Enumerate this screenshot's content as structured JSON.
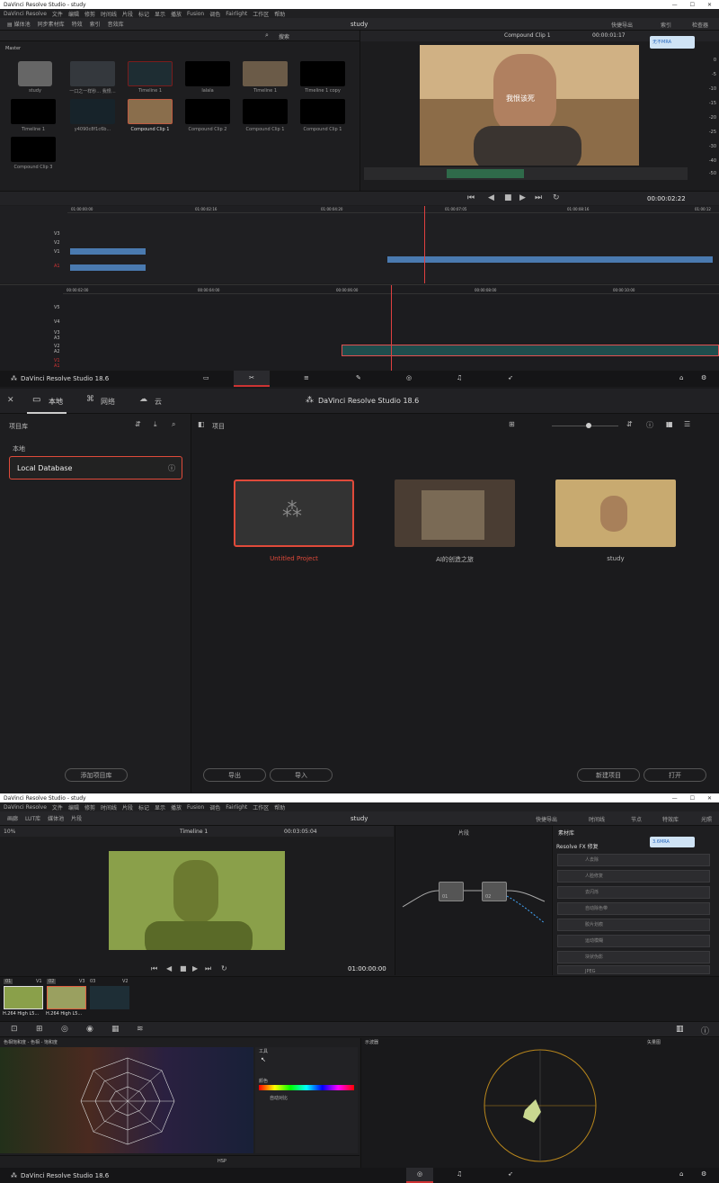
{
  "top": {
    "window_title": "DaVinci Resolve Studio - study",
    "menu": [
      "DaVinci Resolve",
      "文件",
      "编辑",
      "修剪",
      "时间线",
      "片段",
      "标记",
      "显示",
      "播放",
      "Fusion",
      "调色",
      "Fairlight",
      "工作区",
      "帮助"
    ],
    "toolbar": [
      "媒体池",
      "同步素材库",
      "特效",
      "索引",
      "音效库"
    ],
    "project_name": "study",
    "right_tools": [
      "快捷导出",
      "索引",
      "检查器"
    ],
    "search_label": "搜索",
    "bin_label": "Master",
    "clip_name": "Compound Clip 1",
    "timecode_top": "00:00:01:17",
    "badge": "无不MRA",
    "subtitle_overlay": "我恨该死",
    "timecode_main": "00:00:02:22",
    "ruler_top": [
      "01:00:00:00",
      "01:00:02:16",
      "01:00:04:20",
      "01:00:07:05",
      "01:00:08:16",
      "01:00:12"
    ],
    "ruler_bottom": [
      "00:00:02:00",
      "00:00:04:00",
      "00:00:06:00",
      "00:00:08:00",
      "00:00:10:00"
    ],
    "video_tracks": [
      "V3",
      "V2",
      "V1",
      "A1"
    ],
    "lower_tracks": [
      "V5",
      "V4",
      "V3",
      "A3",
      "V2",
      "A2",
      "V1",
      "A1"
    ],
    "meter_scale": [
      "0",
      "-5",
      "-10",
      "-15",
      "-20",
      "-25",
      "-30",
      "-40",
      "-50"
    ],
    "media": [
      {
        "name": "study"
      },
      {
        "name": "一口之一样秒…  我恨…"
      },
      {
        "name": "Timeline 1"
      },
      {
        "name": "lalala"
      },
      {
        "name": "Timeline 1"
      },
      {
        "name": "Timeline 1 copy"
      },
      {
        "name": "Timeline 1"
      },
      {
        "name": "y4090c8f1c6b..."
      },
      {
        "name": "Compound Clip 1"
      },
      {
        "name": "Compound Clip 2"
      },
      {
        "name": "Compound Clip 1"
      },
      {
        "name": "Compound Clip 1"
      },
      {
        "name": "Compound Clip 3"
      }
    ]
  },
  "mid": {
    "tabs": [
      "本地",
      "网络",
      "云"
    ],
    "app_title": "DaVinci Resolve Studio 18.6",
    "library_label": "项目库",
    "local_label": "本地",
    "database": "Local Database",
    "projects_label": "项目",
    "projects": [
      {
        "name": "Untitled Project"
      },
      {
        "name": "AI的创造之旅"
      },
      {
        "name": "study"
      }
    ],
    "add_library": "添加项目库",
    "export": "导出",
    "import": "导入",
    "new_project": "新建项目",
    "open": "打开"
  },
  "bot": {
    "window_title": "DaVinci Resolve Studio - study",
    "menu": [
      "DaVinci Resolve",
      "文件",
      "编辑",
      "修剪",
      "时间线",
      "片段",
      "标记",
      "显示",
      "播放",
      "Fusion",
      "调色",
      "Fairlight",
      "工作区",
      "帮助"
    ],
    "toolbar": [
      "画廊",
      "LUT库",
      "媒体池",
      "片段"
    ],
    "project_name": "study",
    "right_tools": [
      "快捷导出",
      "时间线",
      "节点",
      "特效库",
      "光照"
    ],
    "zoom": "10%",
    "timeline": "Timeline 1",
    "timecode_top": "00:03:05:04",
    "node_label": "片段",
    "fx_tab": "素材库",
    "fx_title": "Resolve FX 修复",
    "fx_items": [
      "人去除",
      "人脸修复",
      "去闪烁",
      "自动除色带",
      "胶片划痕",
      "运动模糊",
      "块状伪影",
      "JPEG"
    ],
    "timecode_main": "01:00:00:00",
    "clips": [
      {
        "id": "01",
        "track": "V1",
        "codec": "H.264 High L5..."
      },
      {
        "id": "02",
        "track": "V3",
        "codec": "H.264 High L5..."
      },
      {
        "id": "03",
        "track": "V2",
        "codec": ""
      }
    ],
    "panel_left": "色相饱和度 - 色相 - 饱和度",
    "panel_right": "示波器",
    "scope_mode": "矢量图",
    "tool_label": "工具",
    "gradient_label": "颜色",
    "option": "自动对比",
    "hsp": "HSP",
    "badge": "3.6MRA"
  },
  "footer": {
    "app": "DaVinci Resolve Studio 18.6"
  }
}
